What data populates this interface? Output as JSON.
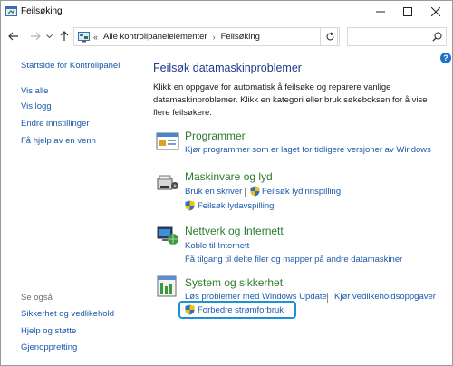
{
  "window": {
    "title": "Feilsøking"
  },
  "navbar": {
    "breadcrumb_prefix": "«",
    "breadcrumb_1": "Alle kontrollpanelelementer",
    "breadcrumb_2": "Feilsøking",
    "search_placeholder": ""
  },
  "left_pane": {
    "home": "Startside for Kontrollpanel",
    "links": [
      "Vis alle",
      "Vis logg",
      "Endre innstillinger",
      "Få hjelp av en venn"
    ],
    "see_also_title": "Se også",
    "see_also": [
      "Sikkerhet og vedlikehold",
      "Hjelp og støtte",
      "Gjenoppretting"
    ]
  },
  "main": {
    "title": "Feilsøk datamaskinproblemer",
    "description": "Klikk en oppgave for automatisk å feilsøke og reparere vanlige datamaskinproblemer. Klikk en kategori eller bruk søkeboksen for å vise flere feilsøkere.",
    "categories": [
      {
        "title": "Programmer",
        "links": [
          "Kjør programmer som er laget for tidligere versjoner av Windows"
        ]
      },
      {
        "title": "Maskinvare og lyd",
        "links": [
          "Bruk en skriver",
          "Feilsøk lydinnspilling",
          "Feilsøk lydavspilling"
        ]
      },
      {
        "title": "Nettverk og Internett",
        "links": [
          "Koble til Internett",
          "Få tilgang til delte filer og mapper på andre datamaskiner"
        ]
      },
      {
        "title": "System og sikkerhet",
        "links": [
          "Løs problemer med Windows Update",
          "Kjør vedlikeholdsoppgaver",
          "Forbedre strømforbruk"
        ]
      }
    ]
  },
  "colors": {
    "link": "#1a58a8",
    "category_title": "#2c7a2c",
    "main_title": "#1e3a8a",
    "highlight_border": "#1e90d6"
  }
}
